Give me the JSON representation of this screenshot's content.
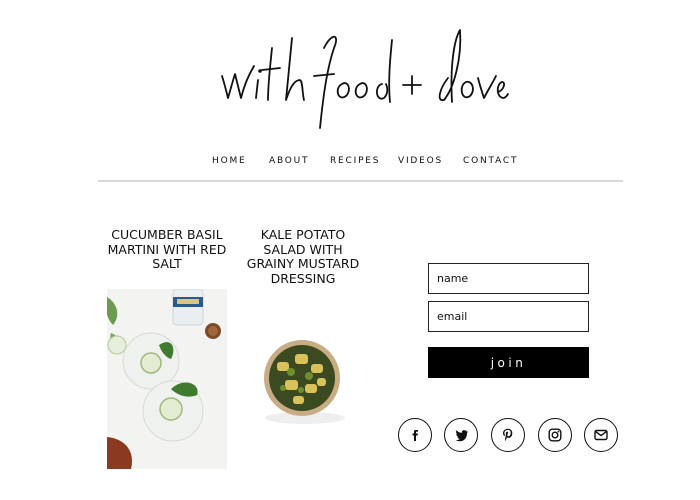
{
  "site": {
    "logo_text": "with food + love"
  },
  "nav": {
    "home": "HOME",
    "about": "ABOUT",
    "recipes": "RECIPES",
    "videos": "VIDEOS",
    "contact": "CONTACT"
  },
  "posts": [
    {
      "title": "Cucumber Basil Martini with Red Salt"
    },
    {
      "title": "Kale Potato Salad with Grainy Mustard Dressing"
    }
  ],
  "signup": {
    "name_placeholder": "name",
    "email_placeholder": "email",
    "join_label": "join"
  },
  "social": [
    "facebook-icon",
    "twitter-icon",
    "pinterest-icon",
    "instagram-icon",
    "email-icon"
  ]
}
